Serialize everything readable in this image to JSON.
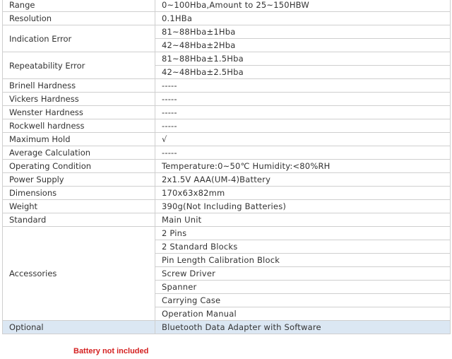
{
  "rows": [
    {
      "label": "Range",
      "values": [
        "0~100Hba,Amount to 25~150HBW"
      ]
    },
    {
      "label": "Resolution",
      "values": [
        "0.1HBa"
      ]
    },
    {
      "label": "Indication Error",
      "values": [
        "81~88Hba±1Hba",
        "42~48Hba±2Hba"
      ]
    },
    {
      "label": "Repeatability Error",
      "values": [
        "81~88Hba±1.5Hba",
        "42~48Hba±2.5Hba"
      ]
    },
    {
      "label": "Brinell Hardness",
      "values": [
        "-----"
      ]
    },
    {
      "label": "Vickers Hardness",
      "values": [
        "-----"
      ]
    },
    {
      "label": "Wenster Hardness",
      "values": [
        "-----"
      ]
    },
    {
      "label": "Rockwell hardness",
      "values": [
        "-----"
      ]
    },
    {
      "label": "Maximum Hold",
      "values": [
        "√"
      ]
    },
    {
      "label": "Average Calculation",
      "values": [
        "-----"
      ]
    },
    {
      "label": "Operating Condition",
      "values": [
        "Temperature:0~50℃   Humidity:<80%RH"
      ]
    },
    {
      "label": "Power Supply",
      "values": [
        "2x1.5V AAA(UM-4)Battery"
      ]
    },
    {
      "label": "Dimensions",
      "values": [
        "170x63x82mm"
      ]
    },
    {
      "label": "Weight",
      "values": [
        "390g(Not Including Batteries)"
      ]
    },
    {
      "label": "Standard",
      "values": [
        "Main Unit"
      ]
    },
    {
      "label": "Accessories",
      "values": [
        "2 Pins",
        "2 Standard Blocks",
        "Pin Length Calibration Block",
        "Screw Driver",
        "Spanner",
        "Carrying Case",
        "Operation Manual"
      ]
    },
    {
      "label": "Optional",
      "values": [
        "Bluetooth Data Adapter with Software"
      ]
    }
  ],
  "note": "Battery not included",
  "colors": {
    "highlight_row": "#dbe7f3",
    "note_text": "#d42020"
  }
}
